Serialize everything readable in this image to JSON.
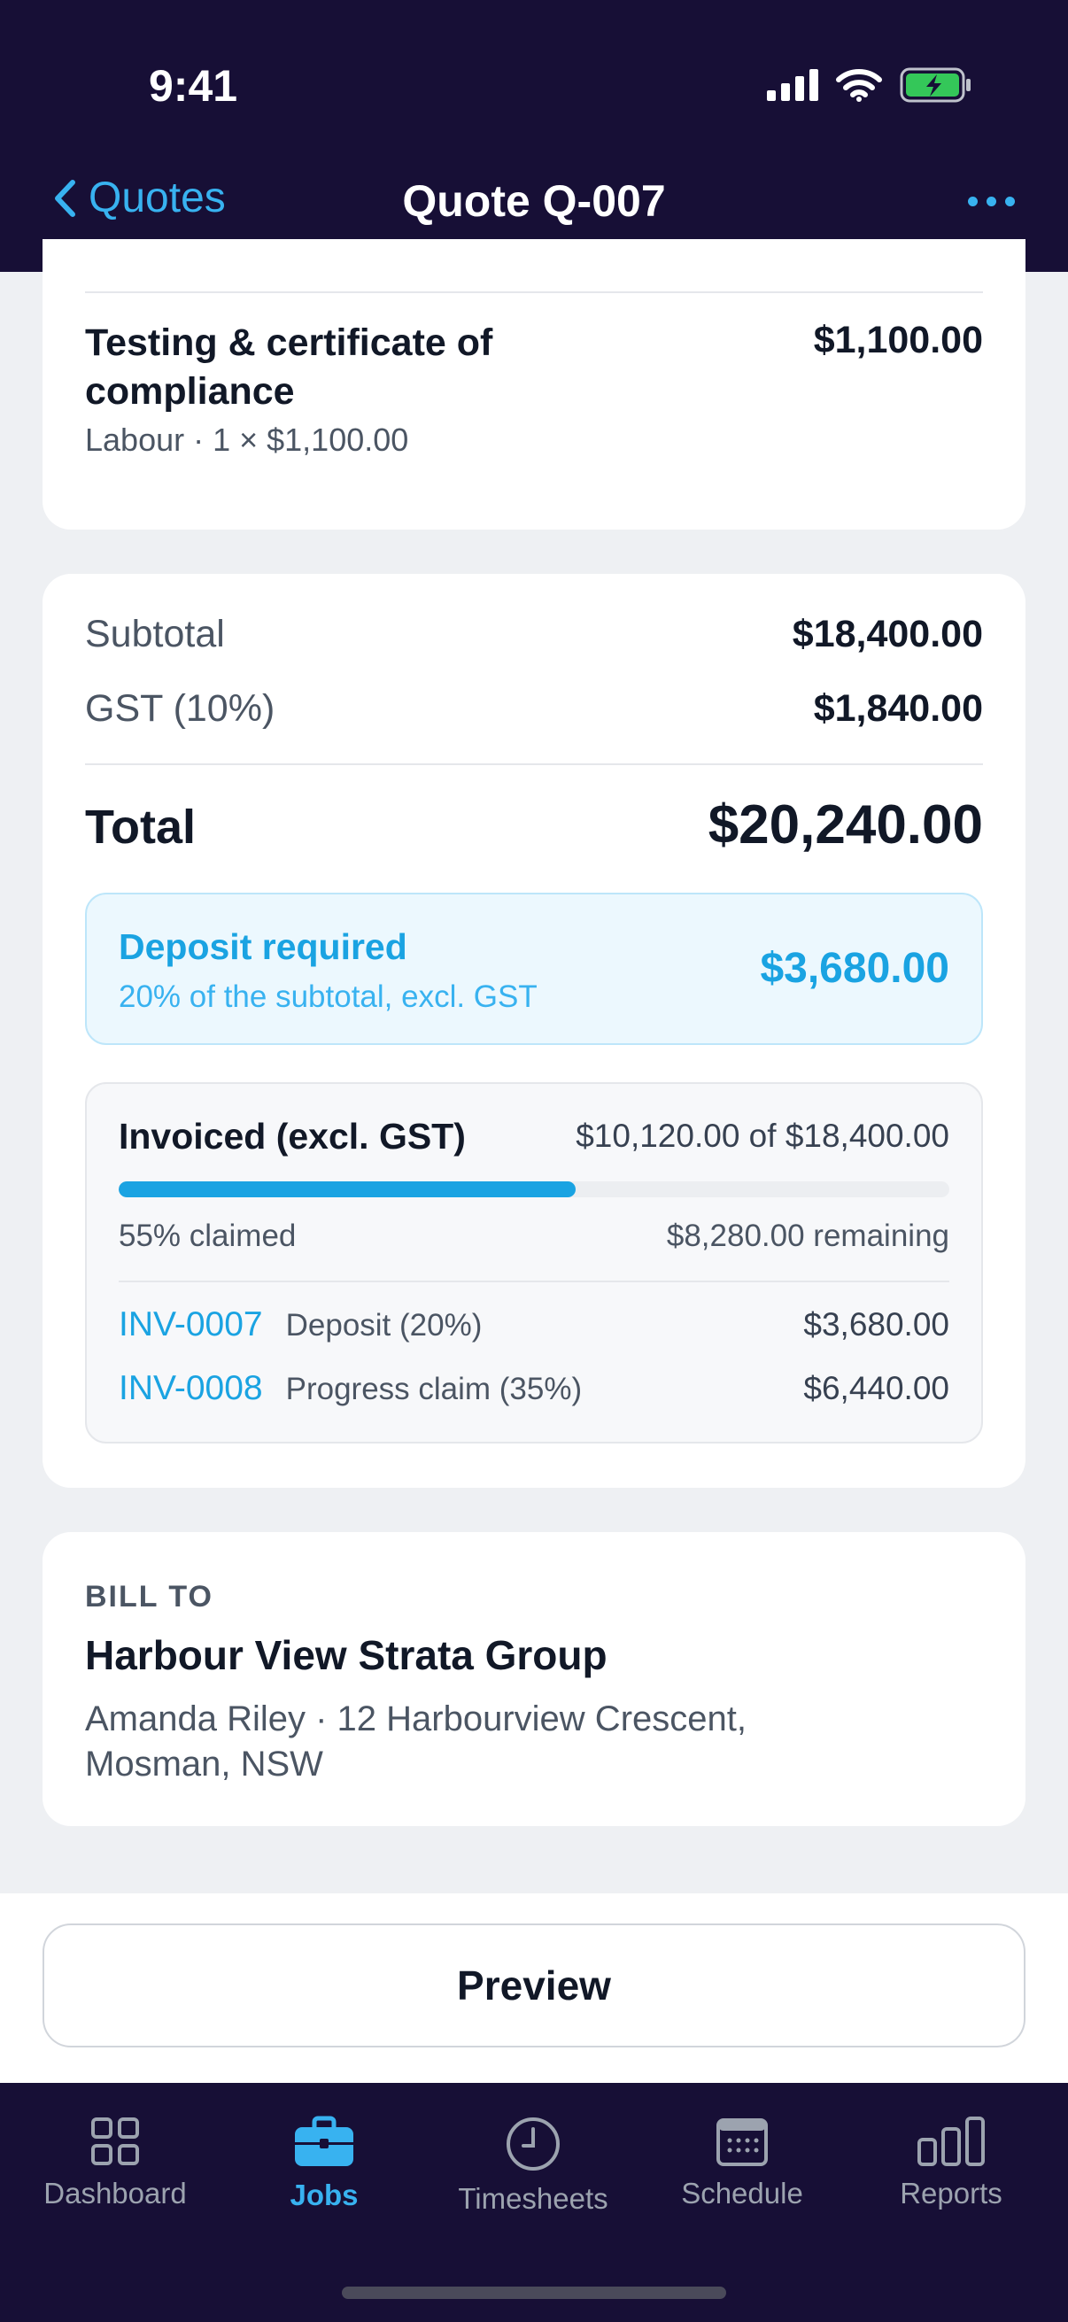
{
  "status_bar": {
    "time": "9:41"
  },
  "nav": {
    "back_label": "Quotes",
    "title": "Quote Q-007"
  },
  "line_item": {
    "description": "Testing & certificate of compliance",
    "meta": "Labour · 1 × $1,100.00",
    "amount": "$1,100.00"
  },
  "totals": {
    "subtotal_label": "Subtotal",
    "subtotal_value": "$18,400.00",
    "gst_label": "GST (10%)",
    "gst_value": "$1,840.00",
    "total_label": "Total",
    "total_value": "$20,240.00"
  },
  "deposit": {
    "title": "Deposit required",
    "subtitle": "20% of the subtotal, excl. GST",
    "amount": "$3,680.00"
  },
  "invoiced": {
    "title": "Invoiced (excl. GST)",
    "of_text": "$10,120.00 of $18,400.00",
    "progress_fraction": 0.55,
    "claimed": "55% claimed",
    "remaining": "$8,280.00 remaining",
    "invoices": [
      {
        "number": "INV-0007",
        "description": "Deposit (20%)",
        "amount": "$3,680.00"
      },
      {
        "number": "INV-0008",
        "description": "Progress claim (35%)",
        "amount": "$6,440.00"
      }
    ]
  },
  "bill_to": {
    "label": "BILL TO",
    "name": "Harbour View Strata Group",
    "address": "Amanda Riley · 12 Harbourview Crescent, Mosman, NSW"
  },
  "actions": {
    "preview_label": "Preview"
  },
  "tabs": [
    {
      "label": "Dashboard",
      "icon": "grid-icon",
      "active": false
    },
    {
      "label": "Jobs",
      "icon": "briefcase-icon",
      "active": true
    },
    {
      "label": "Timesheets",
      "icon": "clock-icon",
      "active": false
    },
    {
      "label": "Schedule",
      "icon": "calendar-icon",
      "active": false
    },
    {
      "label": "Reports",
      "icon": "bar-chart-icon",
      "active": false
    }
  ],
  "colors": {
    "header_bg": "#170f36",
    "accent": "#1aa3e2",
    "page_bg": "#eef0f3"
  }
}
